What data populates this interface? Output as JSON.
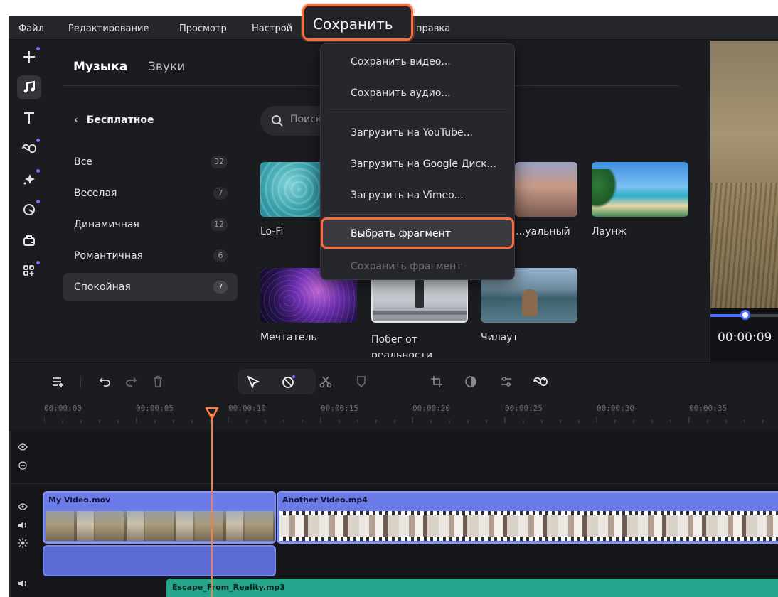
{
  "menubar": {
    "items": [
      "Файл",
      "Редактирование",
      "Просмотр",
      "Настройки",
      "Сохранить",
      "Справка"
    ],
    "file": "Файл",
    "edit": "Редактирование",
    "view": "Просмотр",
    "settings_partial": "Настрой",
    "help_partial": "правка"
  },
  "save_callout": {
    "label": "Сохранить"
  },
  "save_menu": {
    "items": [
      {
        "label": "Сохранить видео...",
        "enabled": true
      },
      {
        "label": "Сохранить аудио...",
        "enabled": true
      },
      {
        "label": "Загрузить на YouTube...",
        "enabled": true
      },
      {
        "label": "Загрузить на Google Диск...",
        "enabled": true
      },
      {
        "label": "Загрузить на Vimeo...",
        "enabled": true
      },
      {
        "label": "Выбрать фрагмент",
        "enabled": true,
        "highlighted": true
      },
      {
        "label": "Сохранить фрагмент",
        "enabled": false
      }
    ]
  },
  "rail": {
    "icons": [
      "add-icon",
      "music-icon",
      "text-icon",
      "transitions-icon",
      "effects-icon",
      "stickers-icon",
      "export-icon",
      "more-icon"
    ],
    "active": "music-icon",
    "accent": "#8a6bff"
  },
  "panel": {
    "tabs": [
      "Музыка",
      "Звуки"
    ],
    "active_tab": "Музыка",
    "back_label": "Бесплатное",
    "categories": [
      {
        "label": "Все",
        "count": "32"
      },
      {
        "label": "Веселая",
        "count": "7"
      },
      {
        "label": "Динамичная",
        "count": "12"
      },
      {
        "label": "Романтичная",
        "count": "6"
      },
      {
        "label": "Спокойная",
        "count": "7",
        "selected": true
      }
    ],
    "search_placeholder": "Поиск",
    "tracks": [
      {
        "title": "Lo-Fi"
      },
      {
        "title": "...уальный"
      },
      {
        "title": "Лаунж"
      },
      {
        "title": "Мечтатель"
      },
      {
        "title": "Побег от реальности"
      },
      {
        "title": "Чилаут"
      }
    ]
  },
  "preview": {
    "timecode": "00:00:09",
    "progress": 0.5,
    "accent": "#4a6cff"
  },
  "timeline": {
    "ruler": [
      "00:00:00",
      "00:00:05",
      "00:00:10",
      "00:00:15",
      "00:00:20",
      "00:00:25",
      "00:00:30",
      "00:00:35"
    ],
    "toolbar_icons": [
      "add-track-icon",
      "undo-icon",
      "redo-icon",
      "delete-icon",
      "select-tool-icon",
      "marker-tool-icon",
      "cut-icon",
      "shield-icon",
      "crop-icon",
      "color-icon",
      "adjust-icon",
      "transition-icon"
    ],
    "clips": [
      {
        "name": "My Video.mov"
      },
      {
        "name": "Another Video.mp4"
      }
    ],
    "audio_clip": "Escape_From_Reality.mp3",
    "playhead_time": "00:00:09",
    "playhead_color": "#ff7a3d",
    "video_clip_color": "#6b7be8",
    "audio_clip_color": "#26a58c"
  }
}
